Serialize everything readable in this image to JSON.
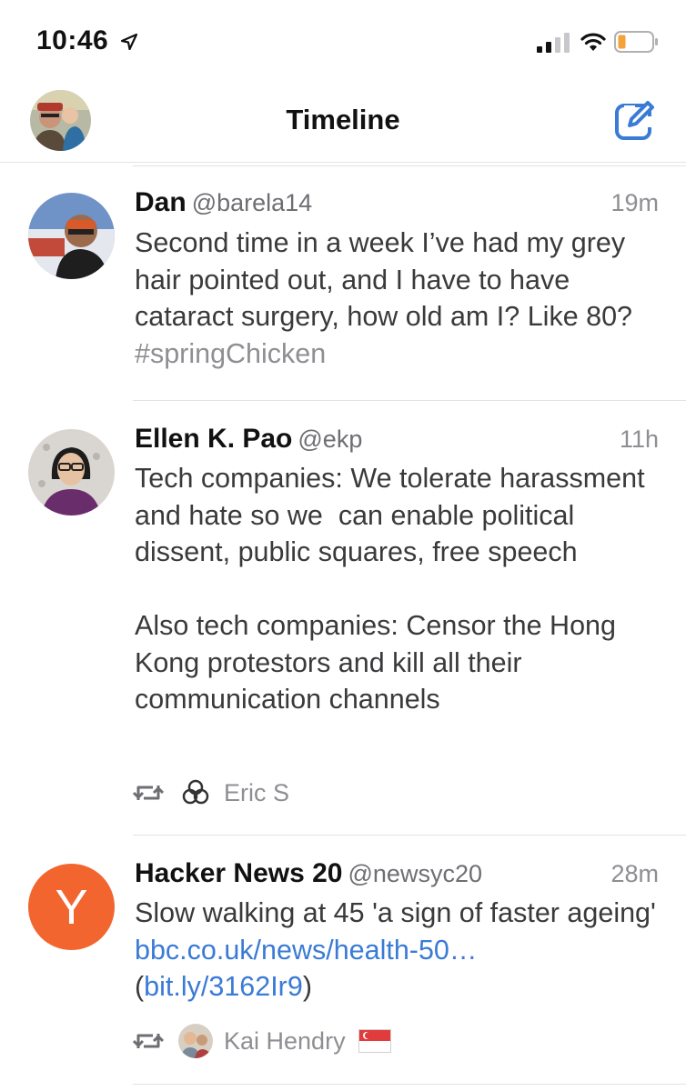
{
  "status_bar": {
    "time": "10:46"
  },
  "nav": {
    "title": "Timeline"
  },
  "tweets": [
    {
      "name": "Dan",
      "handle": "@barela14",
      "time": "19m",
      "text": "Second time in a week I’ve had my grey hair pointed out, and I have to have cataract surgery, how old am I? Like 80? ",
      "hashtag": "#springChicken"
    },
    {
      "name": "Ellen K. Pao",
      "handle": "@ekp",
      "time": "11h",
      "text": "Tech companies: We tolerate harassment and hate so we  can enable political dissent, public squares, free speech\n\nAlso tech companies: Censor the Hong Kong protestors and kill all their communication channels",
      "retweeted_by": "Eric S"
    },
    {
      "name": "Hacker News 20",
      "handle": "@newsyc20",
      "time": "28m",
      "avatar_letter": "Y",
      "text_before": "Slow walking at 45 'a sign of faster ageing' ",
      "link1": "bbc.co.uk/news/health-50…",
      "paren_open": "(",
      "link2": "bit.ly/3162Ir9",
      "paren_close": ")",
      "retweeted_by": "Kai Hendry"
    }
  ],
  "colors": {
    "accent": "#3a7bd5",
    "hn_orange": "#f2652f"
  }
}
